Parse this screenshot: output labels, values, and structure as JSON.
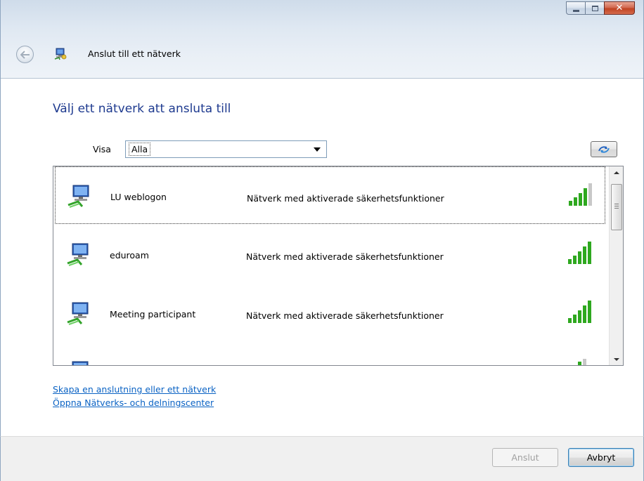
{
  "window": {
    "title": "Anslut till ett nätverk",
    "buttons": {
      "minimize": "minimize",
      "maximize": "maximize",
      "close": "close"
    }
  },
  "main": {
    "heading": "Välj ett nätverk att ansluta till",
    "show": {
      "label": "Visa",
      "selected": "Alla"
    }
  },
  "networks": [
    {
      "name": "LU weblogon",
      "status": "Nätverk med aktiverade säkerhetsfunktioner",
      "signal": 4,
      "selected": true
    },
    {
      "name": "eduroam",
      "status": "Nätverk med aktiverade säkerhetsfunktioner",
      "signal": 5,
      "selected": false
    },
    {
      "name": "Meeting participant",
      "status": "Nätverk med aktiverade säkerhetsfunktioner",
      "signal": 5,
      "selected": false
    },
    {
      "name": "",
      "status": "",
      "signal": 2,
      "selected": false
    }
  ],
  "links": {
    "create": "Skapa en anslutning eller ett nätverk",
    "open_center": "Öppna Nätverks- och delningscenter"
  },
  "footer": {
    "connect_label": "Anslut",
    "cancel_label": "Avbryt"
  },
  "colors": {
    "heading": "#1e3a8f",
    "link": "#0b63c4",
    "signal_on": "#2ea81f",
    "signal_off": "#c8c8c8"
  }
}
